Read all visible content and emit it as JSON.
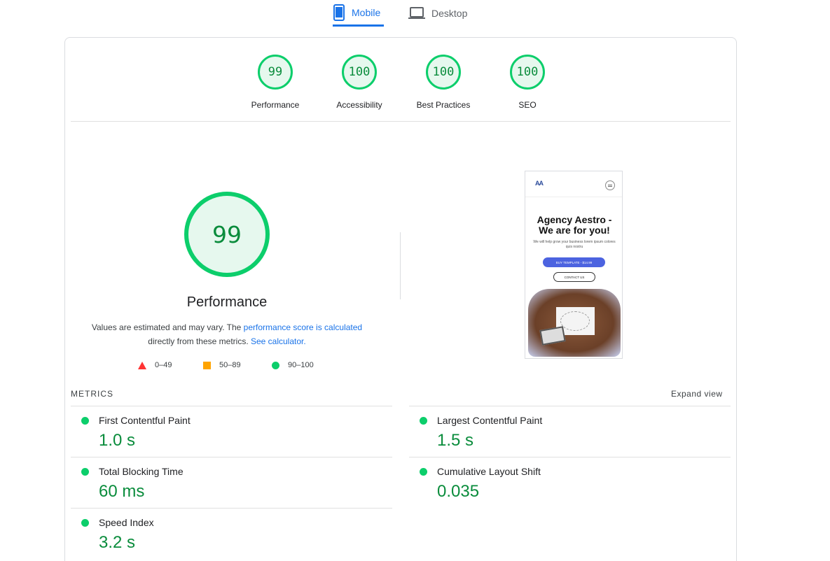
{
  "tabs": {
    "mobile_label": "Mobile",
    "desktop_label": "Desktop"
  },
  "categories": [
    {
      "score": "99",
      "label": "Performance"
    },
    {
      "score": "100",
      "label": "Accessibility"
    },
    {
      "score": "100",
      "label": "Best Practices"
    },
    {
      "score": "100",
      "label": "SEO"
    }
  ],
  "performance": {
    "score": "99",
    "title": "Performance",
    "explain_pre": "Values are estimated and may vary. The ",
    "explain_link1": "performance score is calculated",
    "explain_mid": " directly from these metrics. ",
    "explain_link2": "See calculator."
  },
  "legend": {
    "fail": "0–49",
    "average": "50–89",
    "pass": "90–100"
  },
  "thumbnail": {
    "logo_a": "A",
    "logo_b": "A",
    "headline": "Agency Aestro - We are for you!",
    "subtext": "We will help grow your business lorem ipsum colores quis nostru",
    "button_primary": "BUY TEMPLATE - $14.99",
    "button_secondary": "CONTACT US"
  },
  "metrics": {
    "section_label": "METRICS",
    "expand_label": "Expand view",
    "items": [
      {
        "title": "First Contentful Paint",
        "value": "1.0 s"
      },
      {
        "title": "Largest Contentful Paint",
        "value": "1.5 s"
      },
      {
        "title": "Total Blocking Time",
        "value": "60 ms"
      },
      {
        "title": "Cumulative Layout Shift",
        "value": "0.035"
      },
      {
        "title": "Speed Index",
        "value": "3.2 s"
      }
    ]
  },
  "colors": {
    "pass": "#0cce6b",
    "pass_text": "#0a8c3c",
    "average": "#ffa400",
    "fail": "#ff3333",
    "accent": "#1a73e8"
  }
}
